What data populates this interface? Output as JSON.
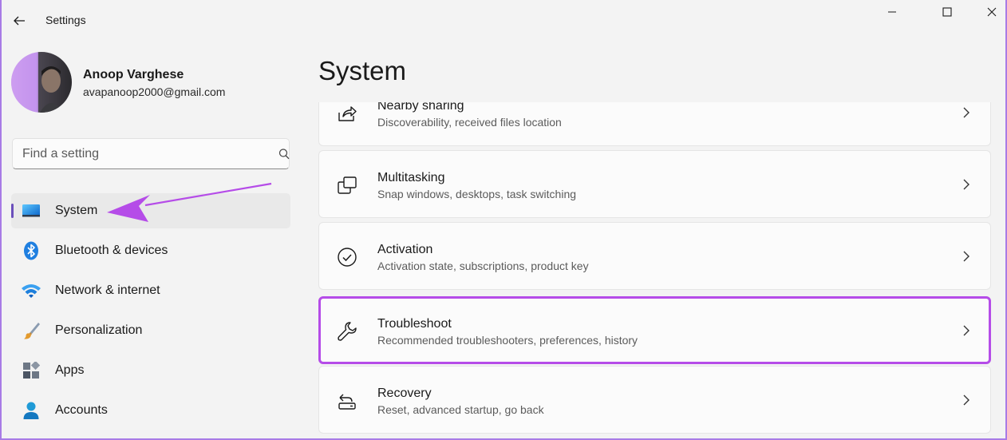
{
  "window": {
    "title": "Settings"
  },
  "profile": {
    "name": "Anoop Varghese",
    "email": "avapanoop2000@gmail.com"
  },
  "search": {
    "placeholder": "Find a setting"
  },
  "nav": {
    "items": [
      {
        "label": "System",
        "icon": "monitor-icon",
        "active": true
      },
      {
        "label": "Bluetooth & devices",
        "icon": "bluetooth-icon"
      },
      {
        "label": "Network & internet",
        "icon": "wifi-icon"
      },
      {
        "label": "Personalization",
        "icon": "paintbrush-icon"
      },
      {
        "label": "Apps",
        "icon": "apps-icon"
      },
      {
        "label": "Accounts",
        "icon": "person-icon"
      }
    ]
  },
  "main": {
    "title": "System",
    "cards": [
      {
        "title": "Nearby sharing",
        "subtitle": "Discoverability, received files location",
        "icon": "share-icon"
      },
      {
        "title": "Multitasking",
        "subtitle": "Snap windows, desktops, task switching",
        "icon": "multitasking-icon"
      },
      {
        "title": "Activation",
        "subtitle": "Activation state, subscriptions, product key",
        "icon": "checkmark-circle-icon"
      },
      {
        "title": "Troubleshoot",
        "subtitle": "Recommended troubleshooters, preferences, history",
        "icon": "wrench-icon",
        "highlighted": true
      },
      {
        "title": "Recovery",
        "subtitle": "Reset, advanced startup, go back",
        "icon": "recovery-icon"
      }
    ]
  },
  "colors": {
    "accent": "#6b4fbb",
    "annotation": "#b54ce8",
    "background": "#f3f3f3",
    "card": "#fbfbfb"
  }
}
